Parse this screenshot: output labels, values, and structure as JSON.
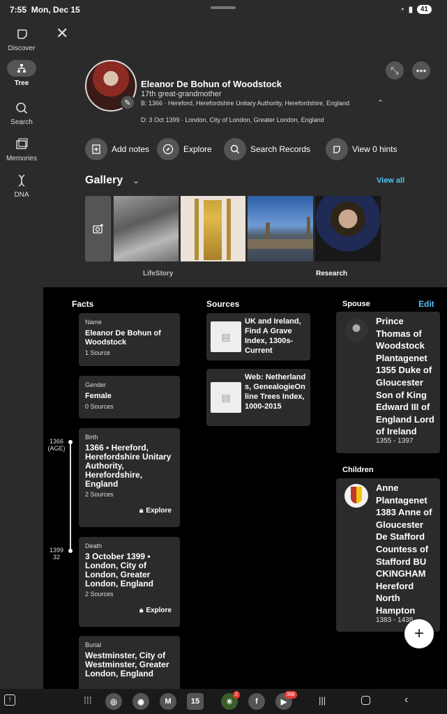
{
  "status": {
    "time": "7:55",
    "date": "Mon, Dec 15",
    "battery": "41"
  },
  "rail": {
    "discover": "Discover",
    "tree": "Tree",
    "search": "Search",
    "memories": "Memories",
    "dna": "DNA"
  },
  "person": {
    "name": "Eleanor De Bohun of Woodstock",
    "relationship": "17th great-grandmother",
    "birth": "B: 1366 · Hereford, Herefordshire Unitary Authority, Herefordshire, England",
    "death": "D: 3 Oct 1399 · London, City of London, Greater London, England"
  },
  "actions": {
    "add_notes": "Add notes",
    "explore": "Explore",
    "search_records": "Search Records",
    "view_hints": "View 0 hints"
  },
  "gallery": {
    "title": "Gallery",
    "view_all": "View all",
    "thumb_labels": [
      "LifeStory",
      "Research"
    ]
  },
  "facts": {
    "title": "Facts",
    "name": {
      "label": "Name",
      "value": "Eleanor De Bohun of Woodstock",
      "sources": "1 Source"
    },
    "gender": {
      "label": "Gender",
      "value": "Female",
      "sources": "0 Sources"
    },
    "birth": {
      "label": "Birth",
      "value": "1366 • Hereford, Herefordshire Unitary Authority, Herefordshire, England",
      "sources": "2 Sources",
      "explore": "Explore"
    },
    "death": {
      "label": "Death",
      "value": "3 October 1399 • London, City of London, Greater London, England",
      "sources": "2 Sources",
      "explore": "Explore"
    },
    "burial": {
      "label": "Burial",
      "value": "Westminster, City of Westminster, Greater London, England"
    }
  },
  "timeline": {
    "start_year": "1366",
    "start_age": "(AGE)",
    "end_year": "1399",
    "end_age": "32"
  },
  "sources": {
    "title": "Sources",
    "items": [
      "UK and Ireland, Find A Grave Index, 1300s-Current",
      "Web: Netherlands, GenealogieOnline Trees Index, 1000-2015"
    ]
  },
  "spouse": {
    "title": "Spouse",
    "edit": "Edit",
    "name": "Prince Thomas of Woodstock Plantagenet 1355 Duke of Gloucester Son of King Edward III of England Lord of Ireland",
    "dates": "1355 - 1397"
  },
  "children": {
    "title": "Children",
    "name": "Anne Plantagenet 1383 Anne of Gloucester De Stafford Countess of Stafford BU CKINGHAM Hereford North Hampton",
    "dates": "1383 - 1438"
  },
  "dock": {
    "cal_day": "15",
    "badge_a": "2",
    "badge_b": "398"
  }
}
